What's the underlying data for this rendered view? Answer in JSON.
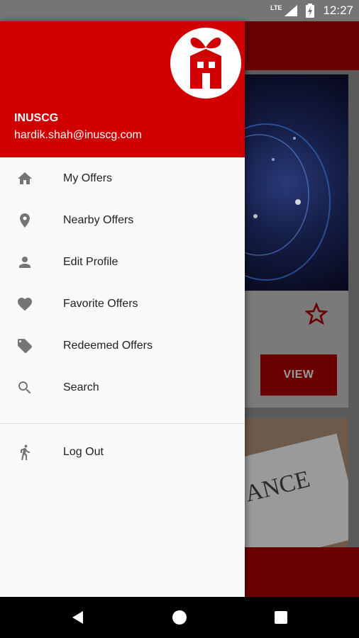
{
  "status_bar": {
    "network": "LTE",
    "time": "12:27"
  },
  "drawer": {
    "user": {
      "name": "INUSCG",
      "email": "hardik.shah@inuscg.com"
    },
    "menu_items": [
      {
        "label": "My Offers",
        "icon": "home-icon"
      },
      {
        "label": "Nearby Offers",
        "icon": "location-pin-icon"
      },
      {
        "label": "Edit Profile",
        "icon": "person-icon"
      },
      {
        "label": "Favorite Offers",
        "icon": "heart-icon"
      },
      {
        "label": "Redeemed Offers",
        "icon": "tag-icon"
      },
      {
        "label": "Search",
        "icon": "search-icon"
      }
    ],
    "logout": {
      "label": "Log Out",
      "icon": "walking-person-icon"
    }
  },
  "background": {
    "view_button": "VIEW",
    "card2_text": "ANCE"
  },
  "colors": {
    "brand_red": "#d10000",
    "drawer_bg": "#fafafa",
    "icon_gray": "#757575"
  }
}
